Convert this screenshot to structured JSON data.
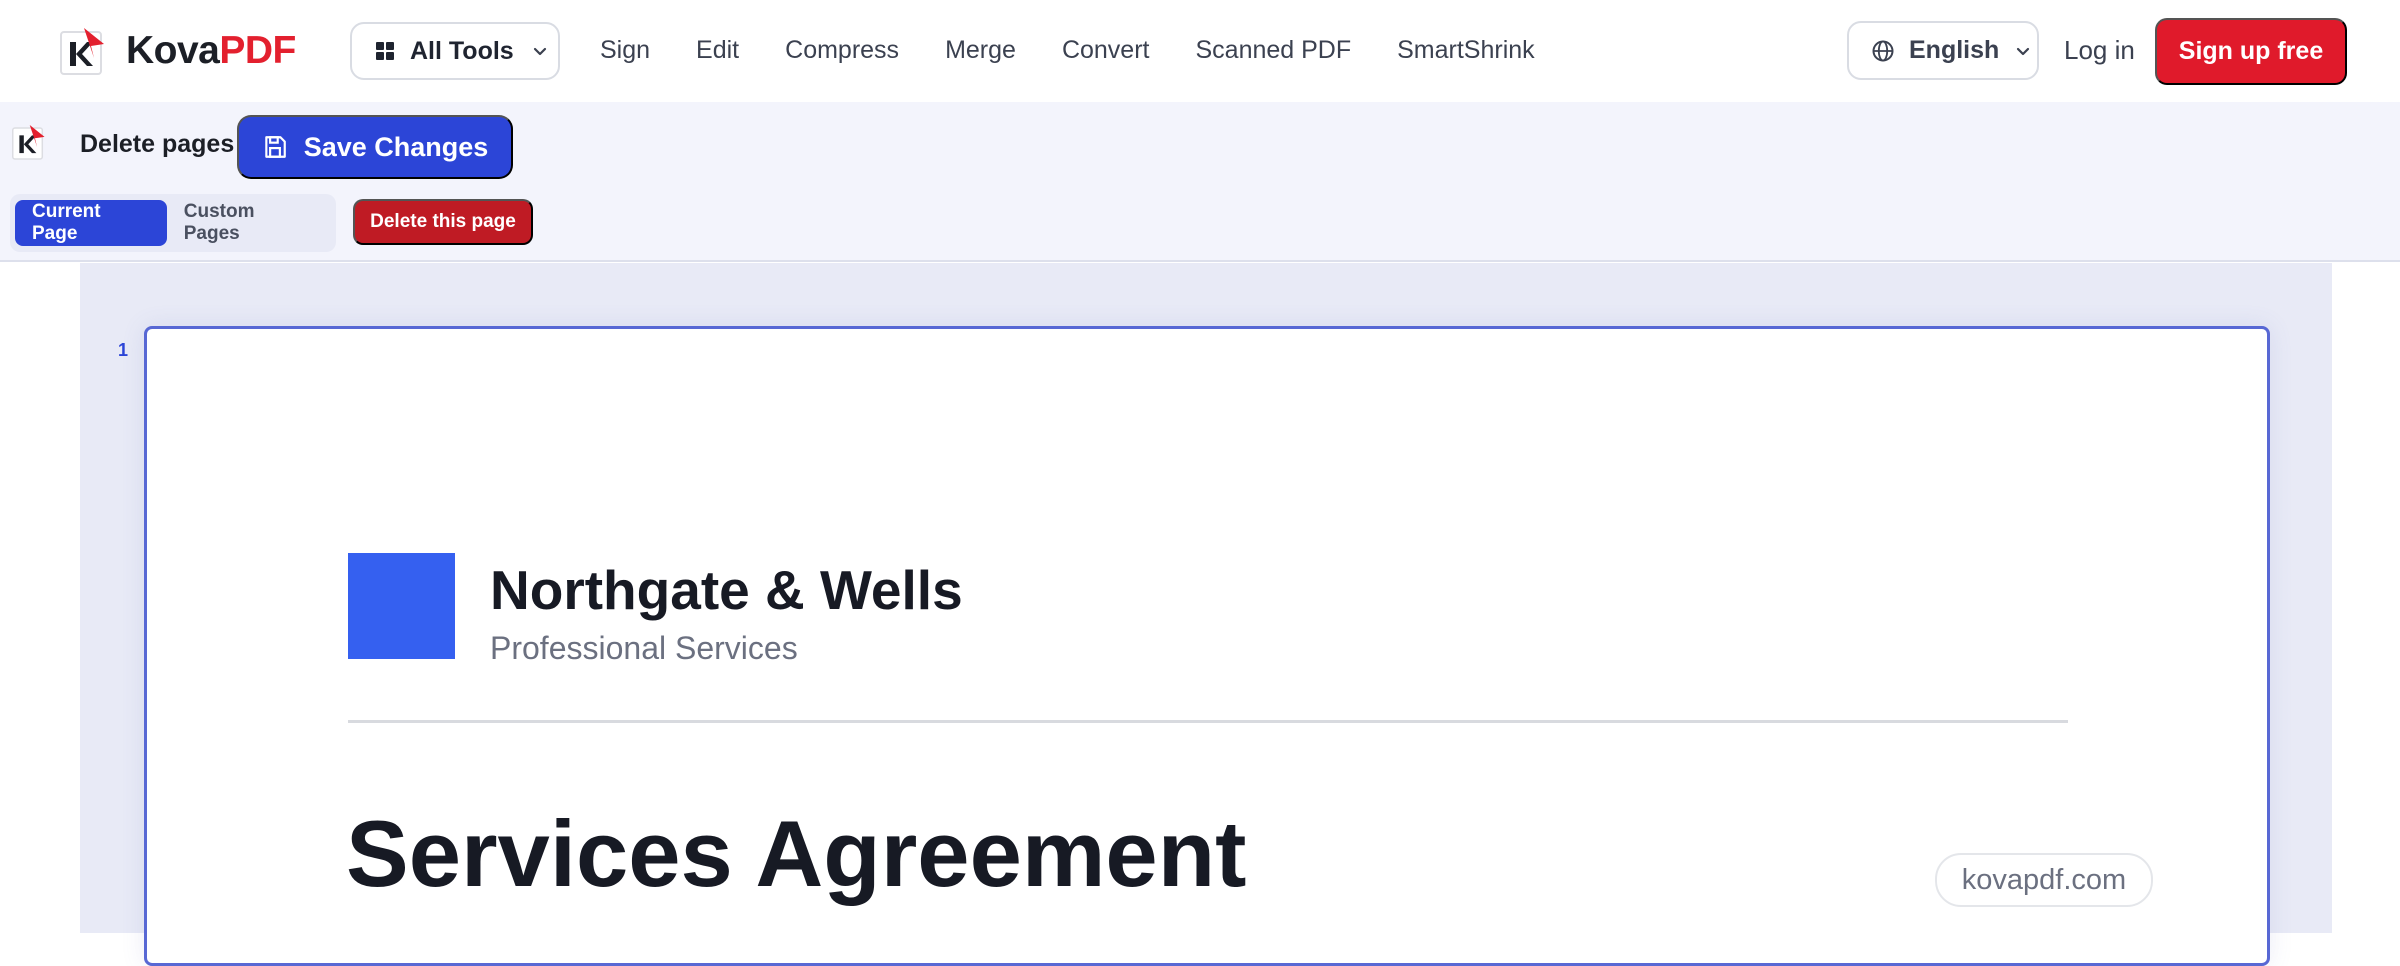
{
  "nav": {
    "brand": {
      "part1": "Kova",
      "part2": "PDF"
    },
    "all_tools_label": "All Tools",
    "links": [
      "Sign",
      "Edit",
      "Compress",
      "Merge",
      "Convert",
      "Scanned PDF",
      "SmartShrink"
    ],
    "language_label": "English",
    "login_label": "Log in",
    "signup_label": "Sign up free"
  },
  "toolbar": {
    "title": "Delete pages",
    "save_label": "Save Changes",
    "mode_tabs": [
      {
        "label": "Current Page",
        "active": true
      },
      {
        "label": "Custom Pages",
        "active": false
      }
    ],
    "delete_label": "Delete this page"
  },
  "document": {
    "page_number": "1",
    "company_name": "Northgate & Wells",
    "company_tagline": "Professional Services",
    "title": "Services Agreement",
    "watermark": "kovapdf.com"
  },
  "colors": {
    "brand_red": "#e01a2b",
    "accent_blue": "#2c45d7",
    "delete_red": "#bf1b24",
    "doc_square": "#3560f0"
  },
  "icons": [
    "kovapdf-logo-icon",
    "grid-icon",
    "chevron-down-icon",
    "globe-icon",
    "save-icon"
  ]
}
